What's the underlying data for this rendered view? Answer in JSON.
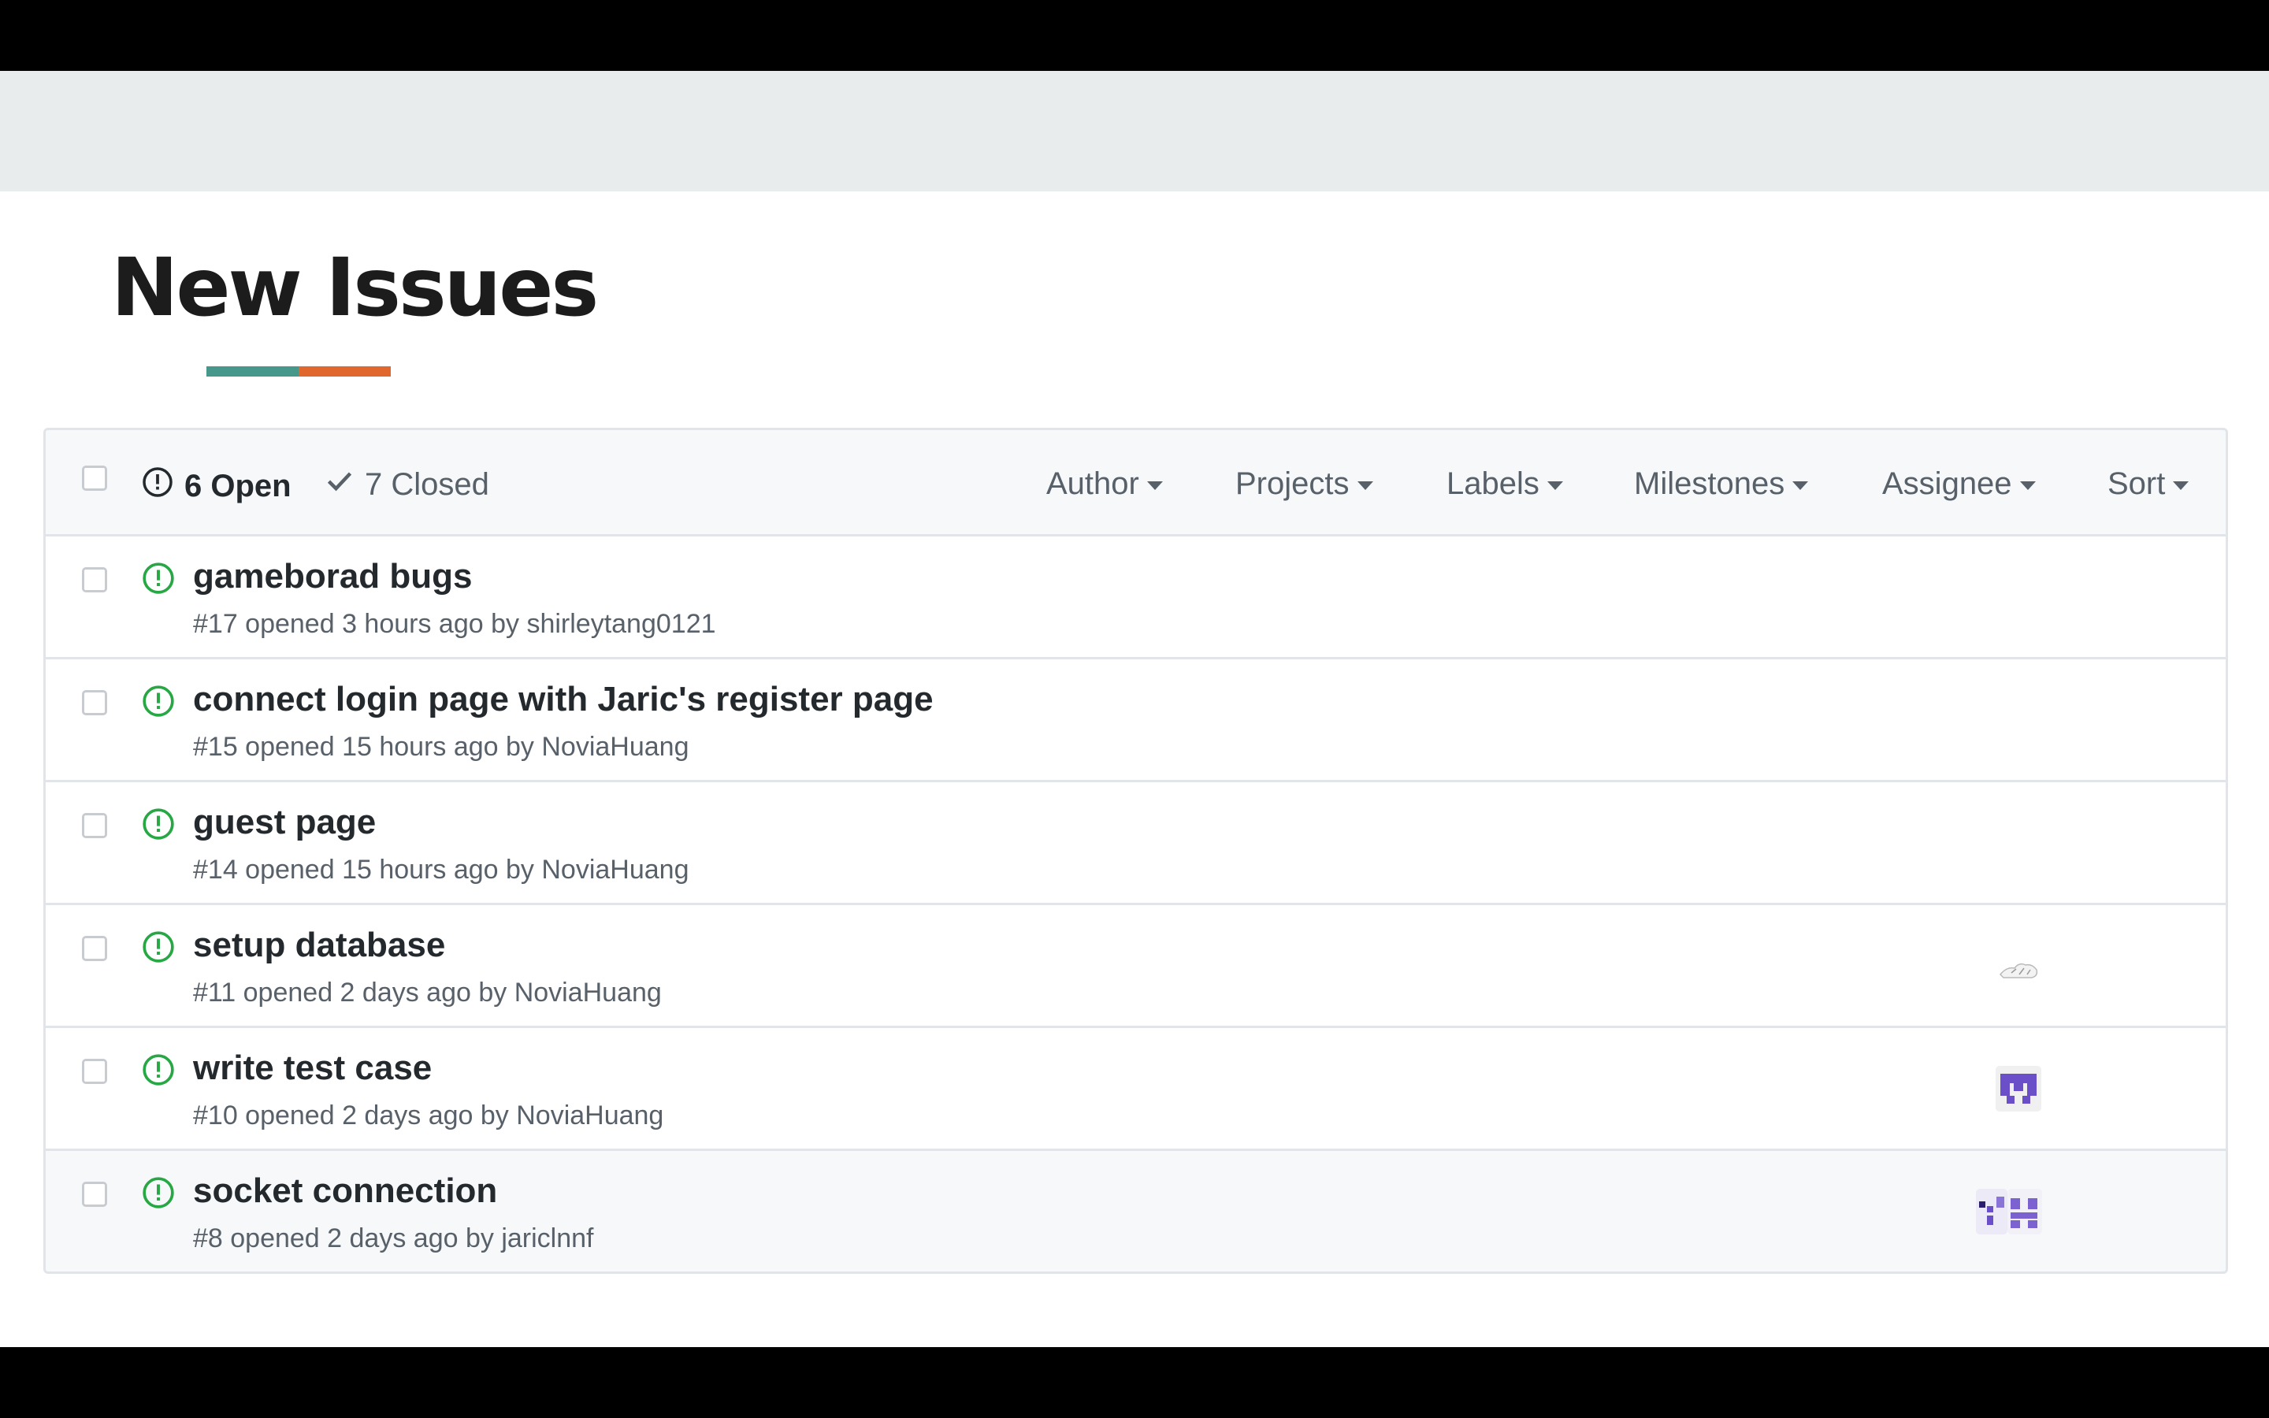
{
  "page": {
    "title": "New Issues"
  },
  "colors": {
    "accent_teal": "#45988a",
    "accent_orange": "#e0672e",
    "open_green": "#28a745",
    "avatar_purple": "#6a4fc8"
  },
  "issues_header": {
    "open_count_label": "6 Open",
    "closed_count_label": "7 Closed",
    "filters": {
      "author": "Author",
      "projects": "Projects",
      "labels": "Labels",
      "milestones": "Milestones",
      "assignee": "Assignee",
      "sort": "Sort"
    }
  },
  "issues": [
    {
      "title": "gameborad bugs",
      "meta": "#17 opened 3 hours ago by shirleytang0121",
      "assignee_avatar": "none"
    },
    {
      "title": "connect login page with Jaric's register page",
      "meta": "#15 opened 15 hours ago by NoviaHuang",
      "assignee_avatar": "none"
    },
    {
      "title": "guest page",
      "meta": "#14 opened 15 hours ago by NoviaHuang",
      "assignee_avatar": "none"
    },
    {
      "title": "setup database",
      "meta": "#11 opened 2 days ago by NoviaHuang",
      "assignee_avatar": "sketch-avatar"
    },
    {
      "title": "write test case",
      "meta": "#10 opened 2 days ago by NoviaHuang",
      "assignee_avatar": "identicon-avatar"
    },
    {
      "title": "socket connection",
      "meta": "#8 opened 2 days ago by jariclnnf",
      "assignee_avatar": "identicon-avatar-pair"
    }
  ]
}
